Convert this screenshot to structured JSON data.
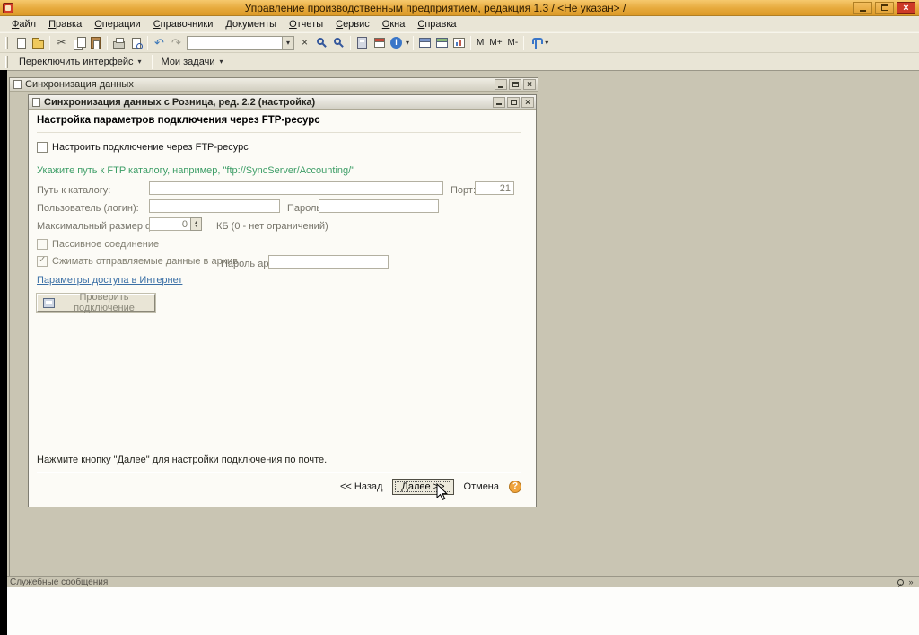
{
  "titlebar": {
    "title": "Управление производственным предприятием, редакция 1.3 / <Не указан> /"
  },
  "menubar": {
    "items": [
      "Файл",
      "Правка",
      "Операции",
      "Справочники",
      "Документы",
      "Отчеты",
      "Сервис",
      "Окна",
      "Справка"
    ]
  },
  "toolbar": {
    "search_value": "",
    "m": [
      "М",
      "М+",
      "М-"
    ]
  },
  "interface_bar": {
    "switch_label": "Переключить интерфейс",
    "tasks_label": "Мои задачи"
  },
  "outer_window": {
    "title": "Синхронизация данных"
  },
  "dialog": {
    "title": "Синхронизация данных с Розница, ред. 2.2 (настройка)",
    "heading": "Настройка параметров подключения через FTP-ресурс",
    "ftp_checkbox": "Настроить подключение через FTP-ресурс",
    "hint": "Укажите путь к FTP каталогу, например, \"ftp://SyncServer/Accounting/\"",
    "path_label": "Путь к каталогу:",
    "path_value": "",
    "port_label": "Порт:",
    "port_value": "21",
    "user_label": "Пользователь (логин):",
    "user_value": "",
    "password_label": "Пароль:",
    "password_value": "",
    "max_size_label": "Максимальный размер файла:",
    "max_size_value": "0",
    "max_size_suffix": "КБ  (0 - нет ограничений)",
    "passive_checkbox": "Пассивное соединение",
    "compress_checkbox": "Сжимать отправляемые данные в архив",
    "archive_password_label": "Пароль архива:",
    "archive_password_value": "",
    "internet_link": "Параметры доступа в Интернет",
    "test_button": "Проверить подключение",
    "footer_hint": "Нажмите кнопку \"Далее\" для настройки подключения по почте.",
    "back_button": "<< Назад",
    "next_button": "Далее >>",
    "cancel_button": "Отмена",
    "help_button": "?"
  },
  "messages_panel": {
    "title": "Служебные сообщения"
  }
}
